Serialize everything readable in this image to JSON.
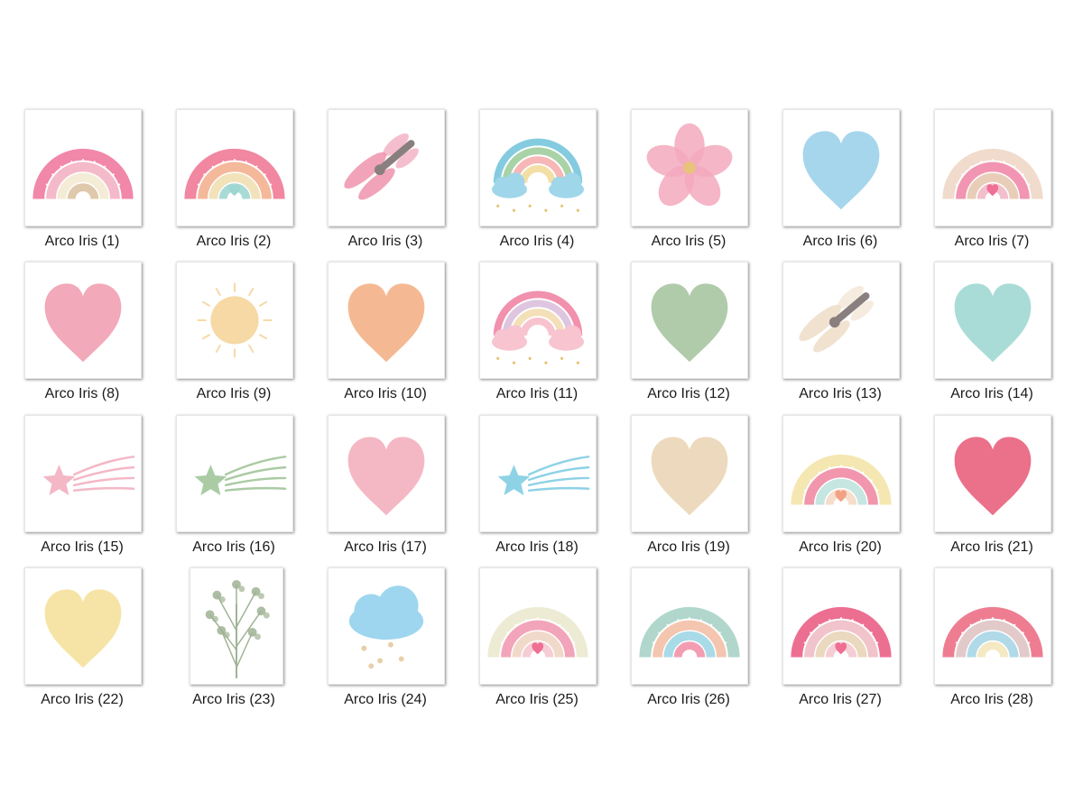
{
  "palette": {
    "pink": "#f07aa0",
    "blush": "#f4b3c4",
    "cream": "#f3ead2",
    "tan": "#dcc3a3",
    "sand": "#e9d6b8",
    "peach": "#f2b28f",
    "sky": "#9fd6ea",
    "aqua": "#a6dcd8",
    "sage": "#aac7a4",
    "lemon": "#f3e3a6",
    "rose": "#e9647f",
    "mauve": "#b9838a"
  },
  "items": [
    {
      "label": "Arco Iris (1)",
      "icon": "rainbow-icon",
      "colors": [
        "#f07aa0",
        "#f4b3c4",
        "#f3ead2",
        "#dcc3a3"
      ],
      "heart": ""
    },
    {
      "label": "Arco Iris (2)",
      "icon": "rainbow-icon",
      "colors": [
        "#f07a96",
        "#f3b08f",
        "#f1dfb2",
        "#9fd6d2"
      ],
      "heart": "#9fd6d2"
    },
    {
      "label": "Arco Iris (3)",
      "icon": "dragonfly-icon",
      "colors": [
        "#ef93ae",
        "#8a7f7f"
      ]
    },
    {
      "label": "Arco Iris (4)",
      "icon": "rainbow-cloud-icon",
      "colors": [
        "#84cbe0",
        "#a9d3a7",
        "#f6b7b6",
        "#f3dfa5",
        "#9fd6ea"
      ]
    },
    {
      "label": "Arco Iris (5)",
      "icon": "flower-icon",
      "colors": [
        "#f3a9bd",
        "#e7c37b"
      ]
    },
    {
      "label": "Arco Iris (6)",
      "icon": "heart-icon",
      "colors": [
        "#9dd3ea"
      ]
    },
    {
      "label": "Arco Iris (7)",
      "icon": "rainbow-icon",
      "colors": [
        "#efd7c6",
        "#ef8aaa",
        "#e6c9b0",
        "#f1b8c6"
      ],
      "heart": "#ef6f95"
    },
    {
      "label": "Arco Iris (8)",
      "icon": "heart-icon",
      "colors": [
        "#f1a2b4"
      ]
    },
    {
      "label": "Arco Iris (9)",
      "icon": "sun-icon",
      "colors": [
        "#f6d9a5"
      ]
    },
    {
      "label": "Arco Iris (10)",
      "icon": "heart-icon",
      "colors": [
        "#f3b38a"
      ]
    },
    {
      "label": "Arco Iris (11)",
      "icon": "rainbow-cloud-icon",
      "colors": [
        "#f191ae",
        "#dec6e0",
        "#f3dfb8",
        "#f6c3ce",
        "#f7c4cf"
      ]
    },
    {
      "label": "Arco Iris (12)",
      "icon": "heart-icon",
      "colors": [
        "#a9c7a3"
      ]
    },
    {
      "label": "Arco Iris (13)",
      "icon": "dragonfly-icon",
      "colors": [
        "#efddc8",
        "#8a7f7f"
      ]
    },
    {
      "label": "Arco Iris (14)",
      "icon": "heart-icon",
      "colors": [
        "#a2d9d4"
      ]
    },
    {
      "label": "Arco Iris (15)",
      "icon": "shooting-star-icon",
      "colors": [
        "#f4b7c6"
      ]
    },
    {
      "label": "Arco Iris (16)",
      "icon": "shooting-star-icon",
      "colors": [
        "#aacba4"
      ]
    },
    {
      "label": "Arco Iris (17)",
      "icon": "heart-icon",
      "colors": [
        "#f3b2bf"
      ]
    },
    {
      "label": "Arco Iris (18)",
      "icon": "shooting-star-icon",
      "colors": [
        "#8ed2e6"
      ]
    },
    {
      "label": "Arco Iris (19)",
      "icon": "heart-icon",
      "colors": [
        "#ecd7b9"
      ]
    },
    {
      "label": "Arco Iris (20)",
      "icon": "rainbow-icon",
      "colors": [
        "#f3e4a8",
        "#ef8ba3",
        "#bfe3de",
        "#f6d9c6"
      ],
      "heart": "#f2a184"
    },
    {
      "label": "Arco Iris (21)",
      "icon": "heart-icon",
      "colors": [
        "#e9647f"
      ]
    },
    {
      "label": "Arco Iris (22)",
      "icon": "heart-icon",
      "colors": [
        "#f5e2a0"
      ]
    },
    {
      "label": "Arco Iris (23)",
      "icon": "branch-icon",
      "colors": [
        "#9fb394"
      ]
    },
    {
      "label": "Arco Iris (24)",
      "icon": "cloud-stars-icon",
      "colors": [
        "#9dd6ee",
        "#e8cfa8"
      ]
    },
    {
      "label": "Arco Iris (25)",
      "icon": "rainbow-icon",
      "colors": [
        "#ece9cf",
        "#f19ab3",
        "#efd5c4",
        "#f5c6d0"
      ],
      "heart": "#ee6f92"
    },
    {
      "label": "Arco Iris (26)",
      "icon": "rainbow-icon",
      "colors": [
        "#a9d3c6",
        "#f3c0a6",
        "#9fd6e4",
        "#f292ab"
      ],
      "heart": ""
    },
    {
      "label": "Arco Iris (27)",
      "icon": "rainbow-icon",
      "colors": [
        "#ea5f86",
        "#efbdc5",
        "#e8d4b8",
        "#f4c8cf"
      ],
      "heart": "#ee6f92"
    },
    {
      "label": "Arco Iris (28)",
      "icon": "rainbow-icon",
      "colors": [
        "#ec6f86",
        "#dfc4c4",
        "#a7d6e6",
        "#f3e7bd"
      ],
      "heart": ""
    }
  ]
}
